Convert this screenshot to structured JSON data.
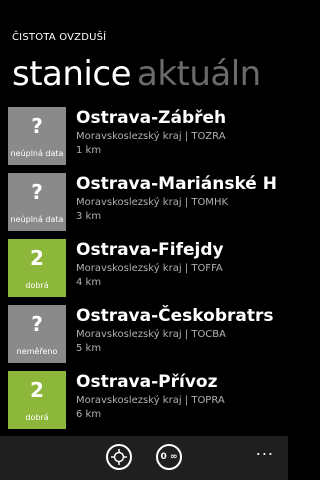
{
  "app": {
    "title": "ČISTOTA OVZDUŠÍ"
  },
  "pivot": {
    "active": "stanice",
    "next": "aktuáln"
  },
  "stations": [
    {
      "tile_value": "?",
      "tile_label": "neúplná data",
      "tile_color": "#8a8a8a",
      "name": "Ostrava-Zábřeh",
      "region": "Moravskoslezský kraj | TOZRA",
      "distance": "1 km"
    },
    {
      "tile_value": "?",
      "tile_label": "neúplná data",
      "tile_color": "#8a8a8a",
      "name": "Ostrava-Mariánské H",
      "region": "Moravskoslezský kraj | TOMHK",
      "distance": "3 km"
    },
    {
      "tile_value": "2",
      "tile_label": "dobrá",
      "tile_color": "#8cb73a",
      "name": "Ostrava-Fifejdy",
      "region": "Moravskoslezský kraj | TOFFA",
      "distance": "4 km"
    },
    {
      "tile_value": "?",
      "tile_label": "neměřeno",
      "tile_color": "#8a8a8a",
      "name": "Ostrava-Českobratrs",
      "region": "Moravskoslezský kraj | TOCBA",
      "distance": "5 km"
    },
    {
      "tile_value": "2",
      "tile_label": "dobrá",
      "tile_color": "#8cb73a",
      "name": "Ostrava-Přívoz",
      "region": "Moravskoslezský kraj | TOPRA",
      "distance": "6 km"
    }
  ],
  "appbar": {
    "locate_icon": "locate-icon",
    "order_icon": "order-icon",
    "order_glyph": "0 ∞",
    "more": "..."
  },
  "colors": {
    "gray_tile": "#8a8a8a",
    "green_tile": "#8cb73a",
    "background": "#000000"
  }
}
